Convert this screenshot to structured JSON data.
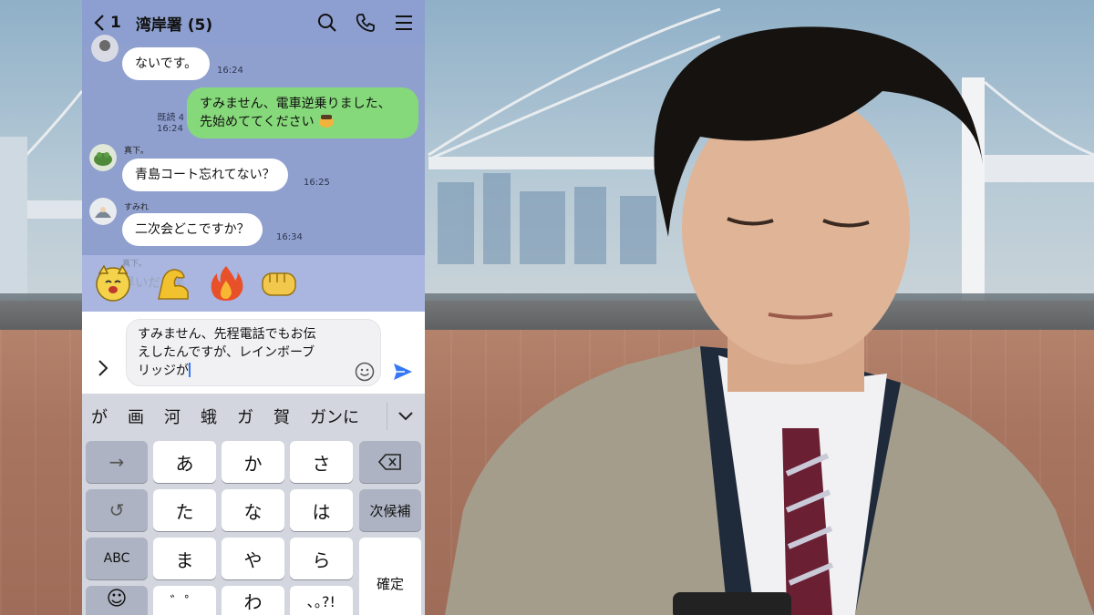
{
  "chat": {
    "back_count": "1",
    "title": "湾岸署 (5)",
    "icons": [
      "search-icon",
      "phone-icon",
      "menu-icon"
    ]
  },
  "messages": [
    {
      "sender": "",
      "text": "ないです。",
      "time": "16:24"
    },
    {
      "sender": "",
      "mine": true,
      "text_line1": "すみません、電車逆乗りました、",
      "text_line2": "先始めててください",
      "read": "既読 4",
      "time": "16:24"
    },
    {
      "sender": "真下。",
      "text": "青島コート忘れてない？",
      "time": "16:25"
    },
    {
      "sender": "すみれ",
      "text": "二次会どこですか？",
      "time": "16:34"
    }
  ],
  "partial_message": {
    "sender": "真下。",
    "text": "早いだろ笑"
  },
  "stickers": [
    "smiling-cat-sticker",
    "flexing-arm-sticker",
    "fire-sticker",
    "fist-sticker"
  ],
  "input": {
    "text": "すみません、先程電話でもお伝\nえしたんですが、レインボーブ\nリッジが"
  },
  "candidates": [
    "が",
    "画",
    "河",
    "蛾",
    "ガ",
    "賀",
    "ガンに"
  ],
  "keyboard": {
    "row1": {
      "fn": "→",
      "keys": [
        "あ",
        "か",
        "さ"
      ],
      "right": "⌫"
    },
    "row2": {
      "fn": "↺",
      "keys": [
        "た",
        "な",
        "は"
      ],
      "right": "次候補"
    },
    "row3": {
      "fn": "ABC",
      "keys": [
        "ま",
        "や",
        "ら"
      ],
      "right": "確定"
    },
    "row4": {
      "fn": "☺",
      "keys": [
        "゛゜",
        "わ",
        "､｡?!"
      ]
    }
  },
  "colors": {
    "chat_bg": "#8fa0cf",
    "mine_bubble": "#86d97a",
    "send": "#3478f6"
  }
}
